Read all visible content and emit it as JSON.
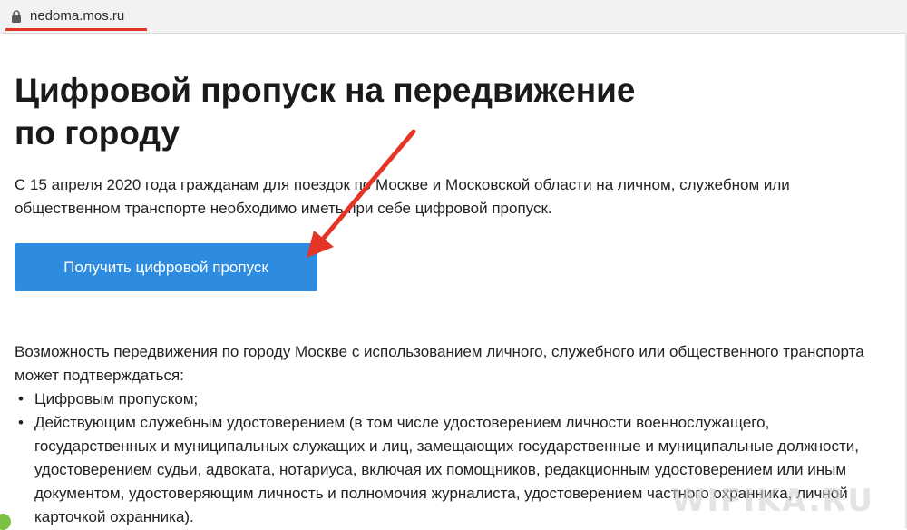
{
  "browser": {
    "url": "nedoma.mos.ru"
  },
  "page": {
    "title_line1": "Цифровой пропуск на передвижение",
    "title_line2": "по городу",
    "intro": "С 15 апреля 2020 года гражданам для поездок по Москве и Московской области на личном, служебном или общественном транспорте необходимо иметь при себе цифровой пропуск.",
    "cta_label": "Получить цифровой пропуск",
    "body_text": "Возможность передвижения по городу Москве с использованием личного, служебного или общественного транспорта может подтверждаться:",
    "bullets": [
      "Цифровым пропуском;",
      "Действующим служебным удостоверением (в том числе удостоверением личности военнослужащего, государственных и муниципальных служащих и лиц, замещающих государственные и муниципальные должности, удостоверением судьи, адвоката, нотариуса, включая их помощников, редакционным удостоверением или иным документом, удостоверяющим личность и полномочия журналиста, удостоверением частного охранника, личной карточкой охранника)."
    ]
  },
  "watermark": {
    "text": "WIFIKA.RU"
  },
  "colors": {
    "cta": "#2e8ce0",
    "annotation": "#e53527"
  },
  "icons": {
    "lock": "lock-icon",
    "arrow": "annotation-arrow"
  }
}
